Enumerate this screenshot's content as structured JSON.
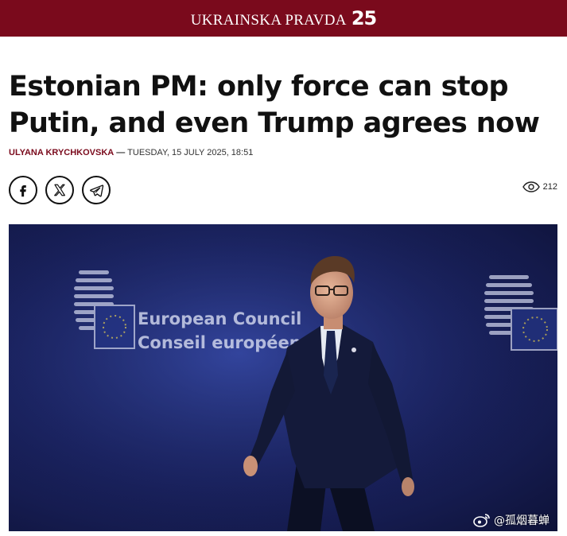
{
  "header": {
    "brand_name": "UKRAINSKA PRAVDA",
    "brand_number": "25",
    "brand_color": "#7a0a1c"
  },
  "article": {
    "title": "Estonian PM: only force can stop Putin, and even Trump agrees now",
    "author": "ULYANA KRYCHKOVSKA",
    "separator": "—",
    "date": "TUESDAY, 15 JULY 2025, 18:51",
    "views": "212"
  },
  "share": {
    "items": [
      {
        "icon": "facebook-icon"
      },
      {
        "icon": "x-icon"
      },
      {
        "icon": "telegram-icon"
      }
    ]
  },
  "photo": {
    "sign_line1": "European Council",
    "sign_line2": "Conseil européen",
    "watermark": "@孤烟暮蝉"
  }
}
